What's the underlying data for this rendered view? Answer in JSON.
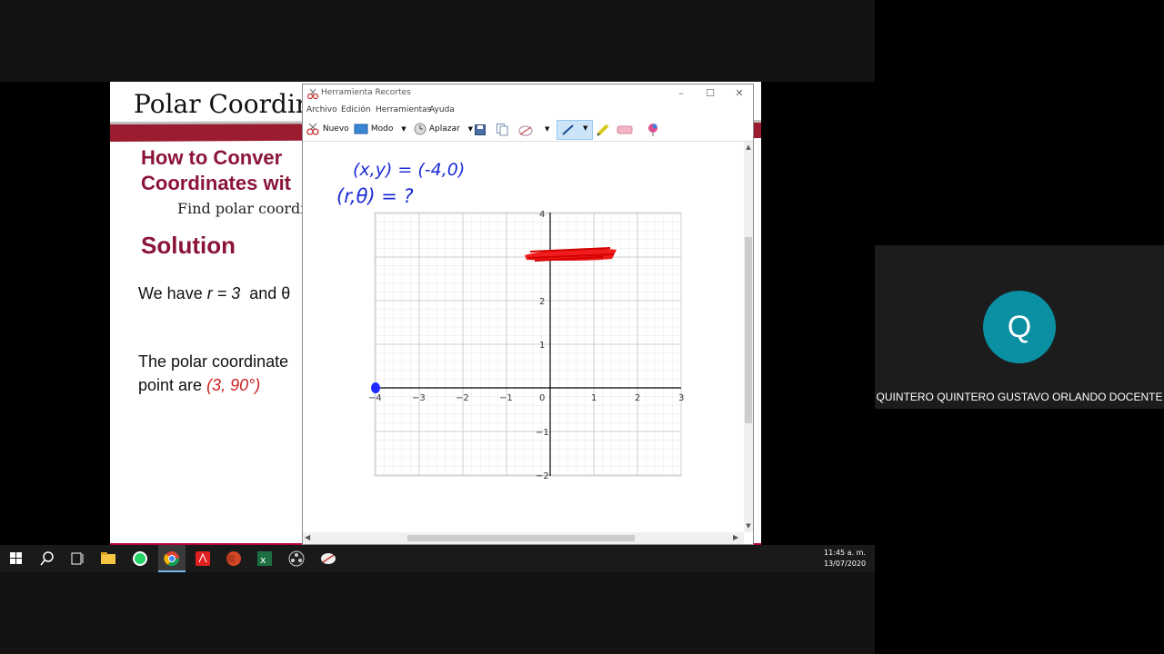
{
  "slide": {
    "title": "Polar Coordina",
    "heading_line1": "How to Conver",
    "heading_line2": "Coordinates wit",
    "find": "Find polar coordi",
    "solution": "Solution",
    "we_have_prefix": "We have ",
    "r_eq": "r = 3",
    "and_theta": "  and θ",
    "polar_line1": "The polar coordinate",
    "point_are": "point are ",
    "point_value": "(3, 90°)"
  },
  "snipping_tool": {
    "title": "Herramienta Recortes",
    "menu": [
      "Archivo",
      "Edición",
      "Herramientas",
      "Ayuda"
    ],
    "toolbar": {
      "new_label": "Nuevo",
      "mode_label": "Modo",
      "delay_label": "Aplazar"
    },
    "handwriting": {
      "line1": "(x,y) = (-4,0)",
      "line2": "(r,θ) = ?"
    },
    "graph": {
      "x_ticks": [
        "−4",
        "−3",
        "−2",
        "−1",
        "0",
        "1",
        "2",
        "3"
      ],
      "y_ticks": [
        "4",
        "2",
        "1",
        "−1",
        "−2"
      ]
    }
  },
  "participant": {
    "initial": "Q",
    "name": "QUINTERO QUINTERO GUSTAVO ORLANDO DOCENTE",
    "avatar_color": "#0a8fa3"
  },
  "taskbar": {
    "time": "11:45 a. m.",
    "date": "13/07/2020",
    "apps": [
      "start-icon",
      "search-icon",
      "task-view-icon",
      "file-explorer-icon",
      "whatsapp-icon",
      "chrome-icon",
      "acrobat-icon",
      "powerpoint-icon",
      "excel-icon",
      "obs-icon",
      "snipping-tool-icon"
    ]
  }
}
